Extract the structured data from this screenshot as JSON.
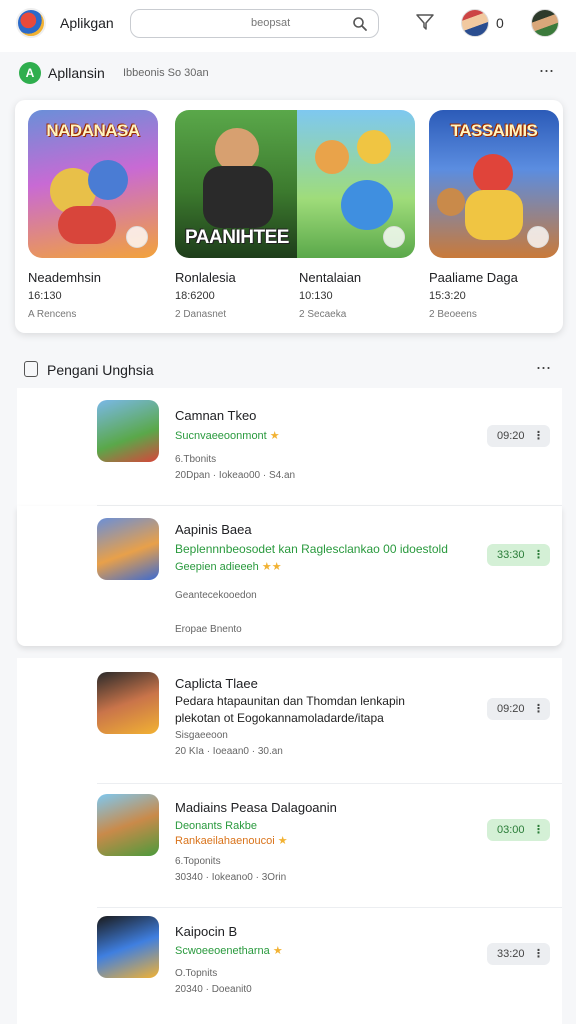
{
  "header": {
    "app_title": "Aplikgan",
    "search_placeholder": "beopsat",
    "avatar_count": "0",
    "icons": {
      "search": "search-icon",
      "filter": "filter-icon"
    }
  },
  "featured": {
    "title": "Apllansin",
    "subtitle": "Ibbeonis So 30an",
    "games": [
      {
        "name": "Neademhsin",
        "time": "16:130",
        "meta": "A Rencens",
        "art_text": "NADANASA"
      },
      {
        "name": "Ronlalesia",
        "time": "18:6200",
        "meta": "2 Danasnet",
        "art_text": "PAANIHTEE"
      },
      {
        "name": "Nentalaian",
        "time": "10:130",
        "meta": "2 Secaeka",
        "art_text": ""
      },
      {
        "name": "Paaliame Daga",
        "time": "15:3:20",
        "meta": "2 Beoeens",
        "art_text": "TASSAIMIS"
      }
    ]
  },
  "list_section": {
    "title": "Pengani Unghsia",
    "items": [
      {
        "title": "Camnan Tkeo",
        "sub": "Sucnvaeeoonmont",
        "sub_color": "green",
        "stars": "★",
        "desc": "",
        "meta": "6.Tbonits",
        "meta2": "20Dpan · Iokeao00 · S4.an",
        "pill": "09:20",
        "pill_green": false
      },
      {
        "title": "Aapinis Baea",
        "sub": "Beplennnbeosodet kan Raglesclankao 00 idoestold",
        "sub_color": "green",
        "sub2": "Geepien adieeeh",
        "stars": "★★",
        "desc": "",
        "meta": "Geantecekooedon",
        "meta2": "Eropae  Bnento",
        "pill": "33:30",
        "pill_green": true
      },
      {
        "title": "Caplicta Tlaee",
        "sub": "",
        "sub_color": "green",
        "stars": "",
        "desc": "Pedara htapaunitan dan Thomdan lenkapin",
        "desc2": "plekotan ot Eogokannamoladarde/itapa",
        "meta": "Sisgaeeoon",
        "meta2": "20 KIa · Ioeaan0 · 30.an",
        "pill": "09:20",
        "pill_green": false
      },
      {
        "title": "Madiains Peasa Dalagoanin",
        "sub": "Deonants Rakbe",
        "sub_color": "green",
        "sub2": "Rankaeilahaenoucoi",
        "stars": "★",
        "desc": "",
        "meta": "6.Toponits",
        "meta2": "30340 · Iokeano0 · 3Orin",
        "pill": "03:00",
        "pill_green": true
      },
      {
        "title": "Kaipocin B",
        "sub": "Scwoeeoenetharna",
        "sub_color": "green",
        "stars": "★",
        "desc": "",
        "meta": "O.Topnits",
        "meta2": "20340 · Doeanit0",
        "pill": "33:20",
        "pill_green": false
      }
    ]
  },
  "colors": {
    "accent_green": "#2fae4e",
    "pill_green_bg": "#d4f0d6",
    "pill_grey_bg": "#eceef1"
  }
}
